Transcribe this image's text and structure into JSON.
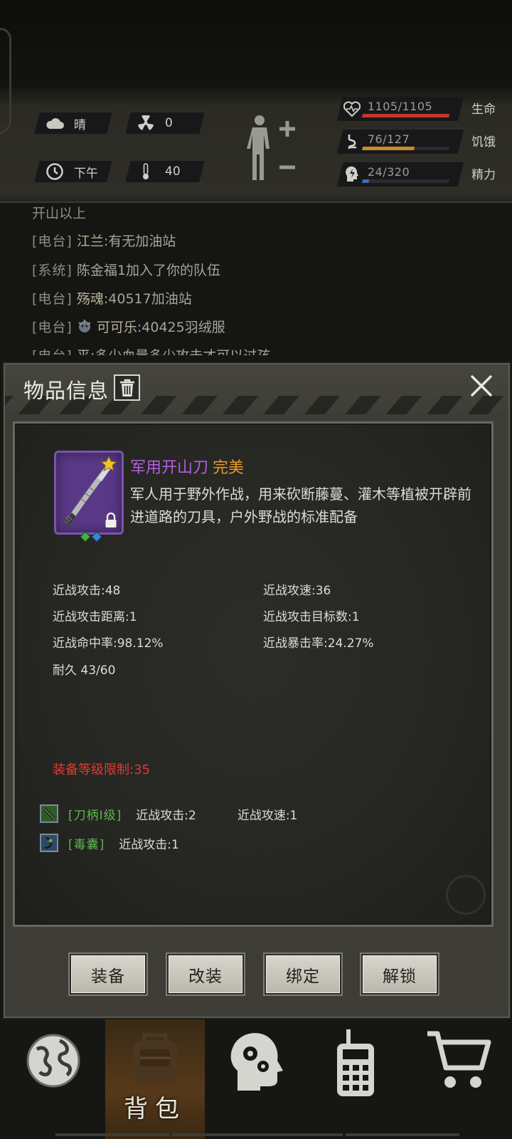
{
  "hud": {
    "weather": {
      "icon": "cloud-icon",
      "label": "晴"
    },
    "radiation": {
      "icon": "radiation-icon",
      "value": "0"
    },
    "time": {
      "icon": "clock-icon",
      "label": "下午"
    },
    "temperature": {
      "icon": "thermometer-icon",
      "value": "40"
    },
    "stats": [
      {
        "name": "生命",
        "value": "1105/1105",
        "fraction": 1.0,
        "color": "#c0392b",
        "icon": "heart-icon"
      },
      {
        "name": "饥饿",
        "value": "76/127",
        "fraction": 0.6,
        "color": "#c98a2c",
        "icon": "stomach-icon"
      },
      {
        "name": "精力",
        "value": "24/320",
        "fraction": 0.075,
        "color": "#3b6fb6",
        "icon": "head-energy-icon"
      }
    ]
  },
  "chat": [
    {
      "text": "开山以上"
    },
    {
      "tag": "[电台]",
      "who": "江兰",
      "msg": ":有无加油站"
    },
    {
      "tag": "[系统]",
      "who": "",
      "msg": "陈金福1加入了你的队伍"
    },
    {
      "tag": "[电台]",
      "who": "殇魂",
      "msg": ":40517加油站"
    },
    {
      "tag": "[电台]",
      "who": "可可乐",
      "msg": ":40425羽绒服",
      "avatar": true
    },
    {
      "tag": "[电台]",
      "who": "平",
      "msg": ":多少血量多少攻击才可以过孩"
    }
  ],
  "modal": {
    "title": "物品信息",
    "item": {
      "name": "军用开山刀",
      "quality": "完美",
      "description": "军人用于野外作战，用来砍断藤蔓、灌木等植被开辟前进道路的刀具，户外野战的标准配备"
    },
    "attributes": {
      "melee_attack": "近战攻击:48",
      "melee_speed": "近战攻速:36",
      "melee_range": "近战攻击距离:1",
      "melee_targets": "近战攻击目标数:1",
      "melee_hit": "近战命中率:98.12%",
      "melee_crit": "近战暴击率:24.27%",
      "durability": "耐久 43/60"
    },
    "level_requirement": "装备等级限制:35",
    "mods": [
      {
        "name": "[刀柄I级]",
        "stats": [
          "近战攻击:2",
          "近战攻速:1"
        ]
      },
      {
        "name": "[毒囊]",
        "stats": [
          "近战攻击:1"
        ]
      }
    ],
    "buttons": {
      "equip": "装备",
      "modify": "改装",
      "bind": "绑定",
      "unlock": "解锁"
    }
  },
  "nav": {
    "active_label": "背包",
    "items": [
      "globe-icon",
      "backpack-icon",
      "head-gears-icon",
      "radio-icon",
      "cart-icon"
    ]
  }
}
